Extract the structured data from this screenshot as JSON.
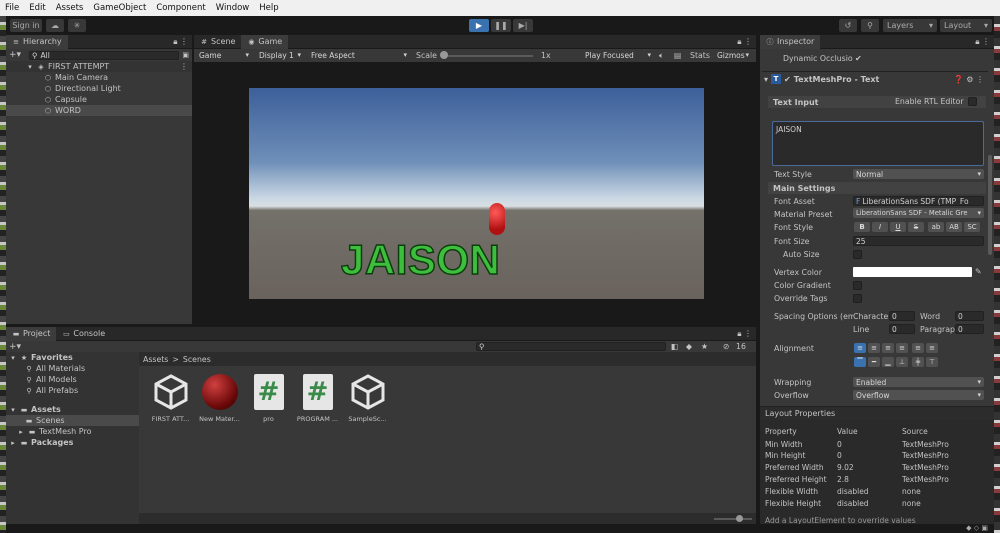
{
  "menu": [
    "File",
    "Edit",
    "Assets",
    "GameObject",
    "Component",
    "Window",
    "Help"
  ],
  "toolbar": {
    "signin": "Sign in",
    "layers": "Layers",
    "layout": "Layout"
  },
  "hierarchy": {
    "tab": "Hierarchy",
    "search_placeholder": "All",
    "scene": "FIRST ATTEMPT",
    "items": [
      "Main Camera",
      "Directional Light",
      "Capsule",
      "WORD"
    ]
  },
  "view": {
    "scene_tab": "Scene",
    "game_tab": "Game",
    "game_dd": "Game",
    "display": "Display 1",
    "aspect": "Free Aspect",
    "scale_label": "Scale",
    "scale_value": "1x",
    "play_focused": "Play Focused",
    "stats": "Stats",
    "gizmos": "Gizmos",
    "game_text": "JAISON"
  },
  "project": {
    "tab": "Project",
    "console_tab": "Console",
    "favorites": "Favorites",
    "fav_items": [
      "All Materials",
      "All Models",
      "All Prefabs"
    ],
    "assets": "Assets",
    "scenes": "Scenes",
    "textmeshpro": "TextMesh Pro",
    "packages": "Packages",
    "breadcrumb_root": "Assets",
    "breadcrumb_sep": ">",
    "breadcrumb_leaf": "Scenes",
    "count": "16",
    "files": [
      "FIRST ATT...",
      "New Mater...",
      "pro",
      "PROGRAM ...",
      "SampleSc..."
    ]
  },
  "inspector": {
    "tab": "Inspector",
    "dyn_occlusion": "Dynamic Occlusio",
    "component": "TextMeshPro - Text",
    "text_input": "Text Input",
    "rtl": "Enable RTL Editor",
    "text_value": "JAISON",
    "text_style_label": "Text Style",
    "text_style": "Normal",
    "main_settings": "Main Settings",
    "font_asset_label": "Font Asset",
    "font_asset": "LiberationSans SDF (TMP_Fo",
    "material_label": "Material Preset",
    "material": "LiberationSans SDF - Metalic Gre",
    "font_style_label": "Font Style",
    "font_style_btns": [
      "B",
      "I",
      "U",
      "S",
      "ab",
      "AB",
      "SC"
    ],
    "font_size_label": "Font Size",
    "font_size": "25",
    "auto_size": "Auto Size",
    "vertex_color": "Vertex Color",
    "color_gradient": "Color Gradient",
    "override_tags": "Override Tags",
    "spacing": "Spacing Options (em)",
    "character": "Characte",
    "char_val": "0",
    "word": "Word",
    "word_val": "0",
    "line": "Line",
    "line_val": "0",
    "paragraph": "Paragrap",
    "para_val": "0",
    "alignment": "Alignment",
    "wrapping_label": "Wrapping",
    "wrapping": "Enabled",
    "overflow_label": "Overflow",
    "overflow": "Overflow",
    "layout_props": "Layout Properties",
    "lp_headers": [
      "Property",
      "Value",
      "Source"
    ],
    "lp_rows": [
      [
        "Min Width",
        "0",
        "TextMeshPro"
      ],
      [
        "Min Height",
        "0",
        "TextMeshPro"
      ],
      [
        "Preferred Width",
        "9.02",
        "TextMeshPro"
      ],
      [
        "Preferred Height",
        "2.8",
        "TextMeshPro"
      ],
      [
        "Flexible Width",
        "disabled",
        "none"
      ],
      [
        "Flexible Height",
        "disabled",
        "none"
      ]
    ],
    "footer_note": "Add a LayoutElement to override values"
  },
  "colors": {
    "accent": "#3a72b0",
    "text_green": "#2ecc40",
    "capsule": "#d11a1a"
  }
}
